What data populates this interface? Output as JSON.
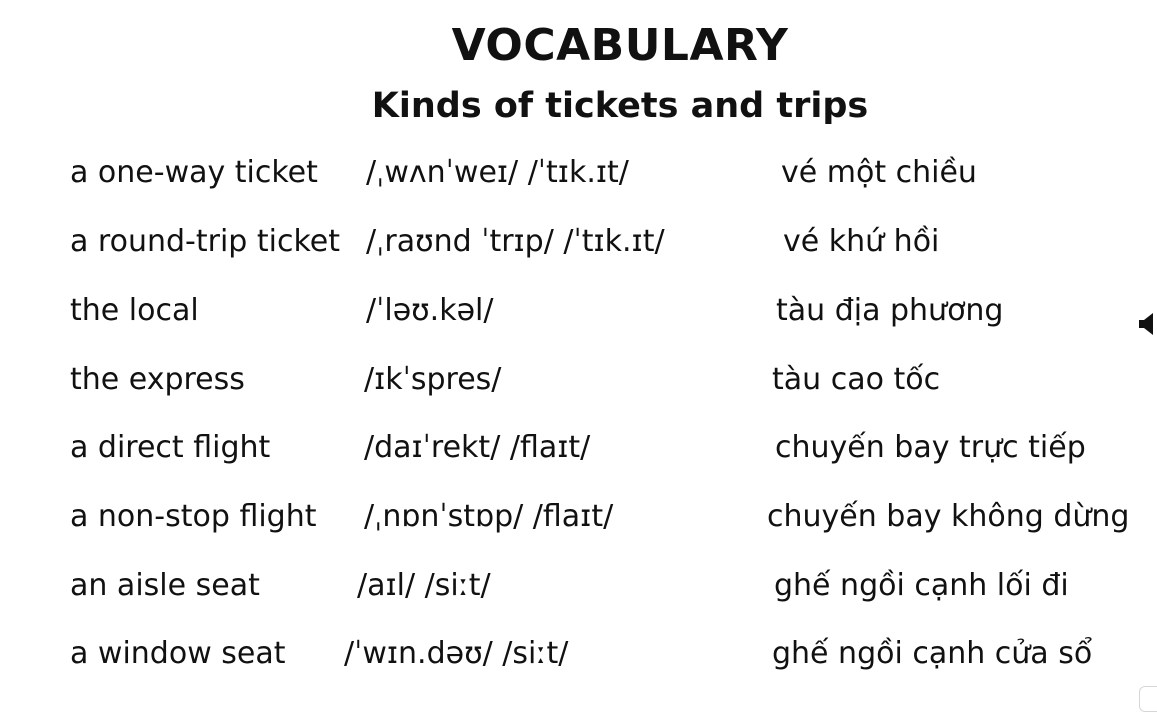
{
  "title": "VOCABULARY",
  "subtitle": "Kinds of tickets and trips",
  "rows": [
    {
      "term": "a one-way ticket",
      "ipa": "/ˌwʌnˈweɪ/  /ˈtɪk.ɪt/",
      "meaning": "vé một chiều"
    },
    {
      "term": "a round-trip ticket",
      "ipa": "/ˌraʊnd ˈtrɪp/ /ˈtɪk.ɪt/",
      "meaning": "vé khứ hồi"
    },
    {
      "term": "the local",
      "ipa": "/ˈləʊ.kəl/",
      "meaning": "tàu địa phương"
    },
    {
      "term": "the express",
      "ipa": "/ɪkˈspres/",
      "meaning": "tàu cao tốc"
    },
    {
      "term": "a direct flight",
      "ipa": "/daɪˈrekt/ /flaɪt/",
      "meaning": "chuyến bay trực tiếp"
    },
    {
      "term": "a non-stop flight",
      "ipa": "/ˌnɒnˈstɒp/ /flaɪt/",
      "meaning": "chuyến bay không dừng"
    },
    {
      "term": "an aisle seat",
      "ipa": "/aɪl/  /siːt/",
      "meaning": "ghế ngồi cạnh lối đi"
    },
    {
      "term": "a window seat",
      "ipa": "/ˈwɪn.dəʊ/ /siːt/",
      "meaning": "ghế ngồi cạnh cửa sổ"
    }
  ],
  "icons": {
    "speaker": "speaker-icon"
  }
}
